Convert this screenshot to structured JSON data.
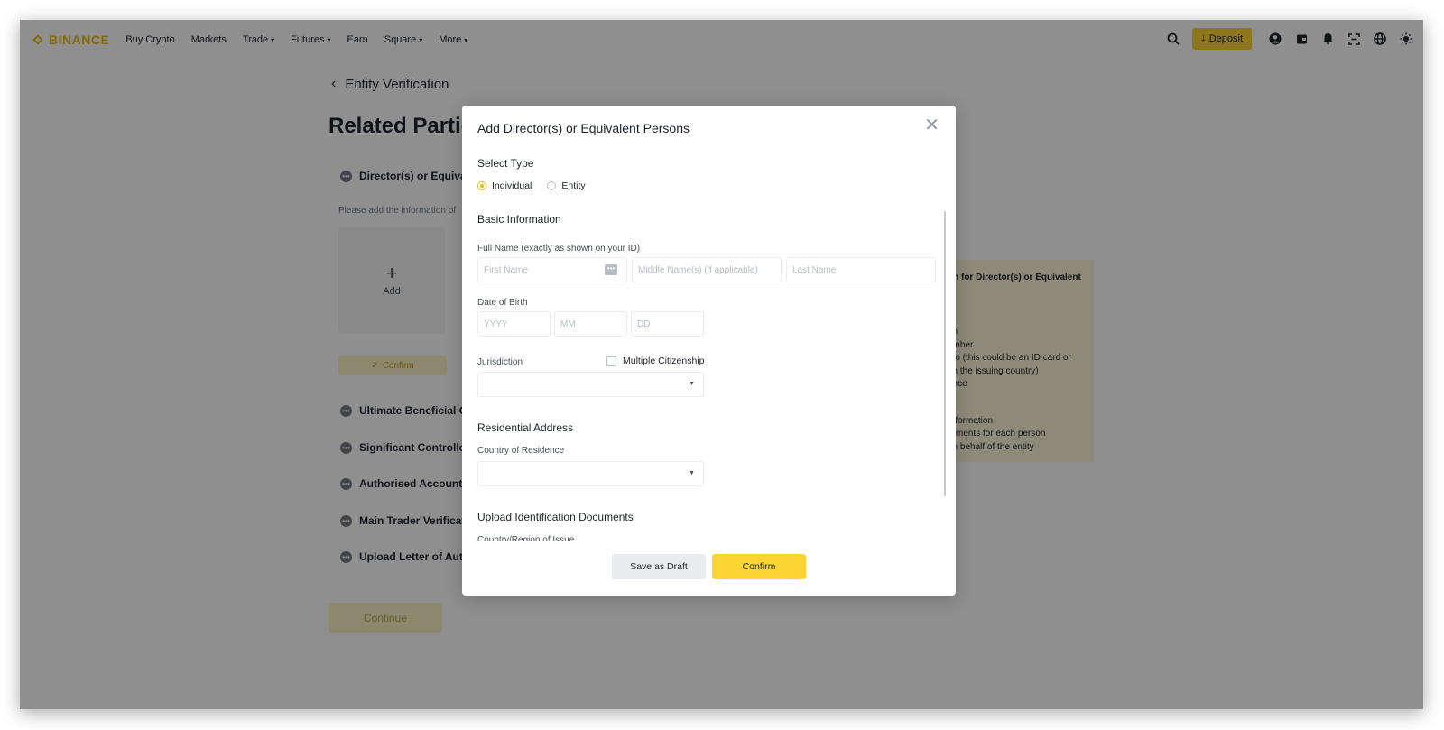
{
  "header": {
    "logo": "BINANCE",
    "nav": [
      {
        "label": "Buy Crypto",
        "chevron": false
      },
      {
        "label": "Markets",
        "chevron": false
      },
      {
        "label": "Trade",
        "chevron": true
      },
      {
        "label": "Futures",
        "chevron": true
      },
      {
        "label": "Earn",
        "chevron": false
      },
      {
        "label": "Square",
        "chevron": true
      },
      {
        "label": "More",
        "chevron": true
      }
    ],
    "deposit_label": "Deposit"
  },
  "page": {
    "back_label": "Entity Verification",
    "title": "Related Parties",
    "steps": [
      "Director(s) or Equivalent Persons",
      "Ultimate Beneficial Owners",
      "Significant Controllers",
      "Authorised Account Traders",
      "Main Trader Verification",
      "Upload Letter of Authorisation"
    ],
    "hint": "Please add the information of",
    "add_label": "Add",
    "confirm_label": "Confirm",
    "continue_label": "Continue",
    "info_panel": [
      "on for Director(s) or Equivalent",
      "on",
      "umber",
      "oto (this could be an ID card or",
      "on the issuing country)",
      "ence",
      "Information",
      "rements for each person",
      "on behalf of the entity"
    ]
  },
  "modal": {
    "title": "Add Director(s) or Equivalent Persons",
    "select_type_label": "Select Type",
    "type_options": [
      "Individual",
      "Entity"
    ],
    "selected_type": "Individual",
    "basic_info_label": "Basic Information",
    "full_name_label": "Full Name (exactly as shown on your ID)",
    "first_name_placeholder": "First Name",
    "middle_name_placeholder": "Middle Name(s) (if applicable)",
    "last_name_placeholder": "Last Name",
    "dob_label": "Date of Birth",
    "dob_year_placeholder": "YYYY",
    "dob_month_placeholder": "MM",
    "dob_day_placeholder": "DD",
    "jurisdiction_label": "Jurisdiction",
    "multiple_citizenship_label": "Multiple Citizenship",
    "residential_address_label": "Residential Address",
    "country_of_residence_label": "Country of Residence",
    "upload_docs_label": "Upload Identification Documents",
    "cut_off_text": "Country/Region of Issue",
    "save_draft_label": "Save as Draft",
    "confirm_label": "Confirm"
  },
  "colors": {
    "accent": "#fcd535",
    "brand": "#f0b90b",
    "overlay": "rgba(0,0,0,0.44)"
  }
}
